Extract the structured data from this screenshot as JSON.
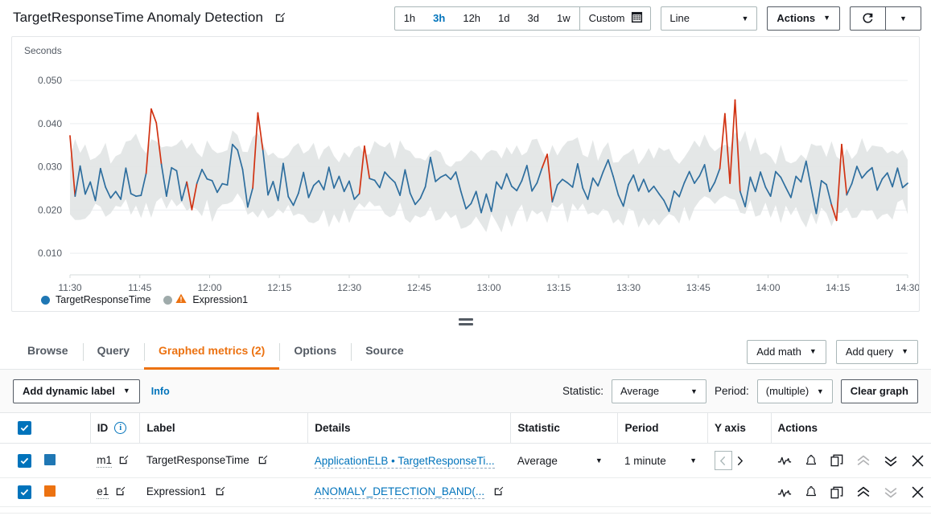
{
  "header": {
    "title": "TargetResponseTime Anomaly Detection",
    "edit_icon": "edit-pencil-icon",
    "time_ranges": [
      {
        "label": "1h",
        "active": false
      },
      {
        "label": "3h",
        "active": true
      },
      {
        "label": "12h",
        "active": false
      },
      {
        "label": "1d",
        "active": false
      },
      {
        "label": "3d",
        "active": false
      },
      {
        "label": "1w",
        "active": false
      }
    ],
    "custom_label": "Custom",
    "custom_icon": "calendar-icon",
    "chart_type": "Line",
    "actions_label": "Actions",
    "refresh_icon": "refresh-icon"
  },
  "chart_data": {
    "type": "line",
    "title": "",
    "ylabel": "Seconds",
    "xlabel": "",
    "ylim": [
      0.005,
      0.053
    ],
    "yticks": [
      0.05,
      0.04,
      0.03,
      0.02,
      0.01
    ],
    "ytick_labels": [
      "0.050",
      "0.040",
      "0.030",
      "0.020",
      "0.010"
    ],
    "xticks": [
      "11:30",
      "11:45",
      "12:00",
      "12:15",
      "12:30",
      "12:45",
      "13:00",
      "13:15",
      "13:30",
      "13:45",
      "14:00",
      "14:15",
      "14:30"
    ],
    "grid": true,
    "legend_position": "bottom-left",
    "legend": [
      {
        "name": "TargetResponseTime",
        "color": "#1f77b4",
        "marker": "circle"
      },
      {
        "name": "Expression1",
        "color": "#98a3a3",
        "marker": "circle",
        "warning_icon": "warning-triangle-icon",
        "warning_color": "#ec7211"
      }
    ],
    "series": [
      {
        "name": "TargetResponseTime",
        "color": "#2e6e9e",
        "anomaly_color": "#d13212",
        "unit": "Seconds",
        "values": [
          0.0372,
          0.0232,
          0.0302,
          0.0237,
          0.0265,
          0.0222,
          0.0296,
          0.0253,
          0.0228,
          0.0243,
          0.0225,
          0.0297,
          0.0238,
          0.0232,
          0.0234,
          0.0285,
          0.0434,
          0.0402,
          0.0306,
          0.0232,
          0.0298,
          0.0291,
          0.0222,
          0.0265,
          0.0201,
          0.0262,
          0.0294,
          0.0272,
          0.0268,
          0.0241,
          0.0261,
          0.0258,
          0.0352,
          0.0339,
          0.0294,
          0.0207,
          0.0251,
          0.0425,
          0.0338,
          0.0235,
          0.0266,
          0.0222,
          0.0308,
          0.0231,
          0.0211,
          0.0239,
          0.0287,
          0.0229,
          0.0257,
          0.0268,
          0.0247,
          0.0299,
          0.0251,
          0.0278,
          0.0243,
          0.0267,
          0.0225,
          0.0238,
          0.0348,
          0.0273,
          0.0269,
          0.0252,
          0.0288,
          0.0275,
          0.0264,
          0.0234,
          0.0293,
          0.0239,
          0.0213,
          0.0227,
          0.0254,
          0.0322,
          0.0266,
          0.0276,
          0.0282,
          0.0271,
          0.0288,
          0.0243,
          0.0203,
          0.0215,
          0.0243,
          0.0194,
          0.0237,
          0.0197,
          0.0265,
          0.0249,
          0.0284,
          0.0255,
          0.0245,
          0.0268,
          0.0303,
          0.0244,
          0.0263,
          0.0298,
          0.0329,
          0.0219,
          0.0258,
          0.0271,
          0.0263,
          0.0253,
          0.0307,
          0.0251,
          0.0225,
          0.0274,
          0.0256,
          0.0288,
          0.0316,
          0.0278,
          0.0235,
          0.0209,
          0.0259,
          0.0281,
          0.0244,
          0.0271,
          0.0242,
          0.0255,
          0.0238,
          0.0222,
          0.0197,
          0.0244,
          0.0231,
          0.0263,
          0.0289,
          0.0262,
          0.0279,
          0.0305,
          0.0243,
          0.0264,
          0.0296,
          0.0423,
          0.0262,
          0.0455,
          0.0243,
          0.0208,
          0.0276,
          0.0243,
          0.0288,
          0.0253,
          0.0232,
          0.0289,
          0.0276,
          0.0252,
          0.0229,
          0.0278,
          0.0265,
          0.0313,
          0.0251,
          0.0192,
          0.0268,
          0.0259,
          0.0212,
          0.0176,
          0.0352,
          0.0235,
          0.0261,
          0.0301,
          0.0274,
          0.0288,
          0.0298,
          0.0246,
          0.0272,
          0.0286,
          0.0254,
          0.0297,
          0.0252,
          0.0262
        ]
      },
      {
        "name": "Expression1",
        "type": "band",
        "color": "#dfe3e3",
        "description": "ANOMALY_DETECTION_BAND lower/upper bounds"
      }
    ]
  },
  "resizer": {
    "icon": "drag-handle-icon"
  },
  "tabs": [
    {
      "label": "Browse",
      "active": false
    },
    {
      "label": "Query",
      "active": false
    },
    {
      "label": "Graphed metrics (2)",
      "active": true
    },
    {
      "label": "Options",
      "active": false
    },
    {
      "label": "Source",
      "active": false
    }
  ],
  "tabs_right": [
    {
      "label": "Add math",
      "icon": "chevron-down-icon"
    },
    {
      "label": "Add query",
      "icon": "chevron-down-icon"
    }
  ],
  "controls": {
    "add_dynamic_label": "Add dynamic label",
    "info_label": "Info",
    "statistic_label": "Statistic:",
    "statistic_value": "Average",
    "period_label": "Period:",
    "period_value": "(multiple)",
    "clear_graph_label": "Clear graph"
  },
  "table": {
    "headers": [
      "",
      "",
      "ID",
      "Label",
      "Details",
      "Statistic",
      "Period",
      "Y axis",
      "Actions"
    ],
    "id_info_icon": "info-icon",
    "rows": [
      {
        "checked": true,
        "color": "#1f77b4",
        "id": "m1",
        "label": "TargetResponseTime",
        "details": "ApplicationELB • TargetResponseTi...",
        "statistic": "Average",
        "period": "1 minute",
        "yaxis_left_icon": "chevron-left-icon",
        "yaxis_right_icon": "chevron-right-icon",
        "actions": [
          "pulse-icon",
          "bell-icon",
          "duplicate-icon",
          "move-up-icon",
          "move-down-icon",
          "close-icon"
        ],
        "move_up_disabled": true,
        "move_down_disabled": false
      },
      {
        "checked": true,
        "color": "#ec7211",
        "id": "e1",
        "label": "Expression1",
        "details": "ANOMALY_DETECTION_BAND(...",
        "statistic": "",
        "period": "",
        "actions": [
          "pulse-icon",
          "bell-icon",
          "duplicate-icon",
          "move-up-icon",
          "move-down-icon",
          "close-icon"
        ],
        "move_up_disabled": false,
        "move_down_disabled": true
      }
    ]
  },
  "colors": {
    "accent_orange": "#ec7211",
    "link_blue": "#0073bb",
    "series_blue": "#2e6e9e",
    "anomaly_red": "#d13212",
    "band_gray": "#dfe3e3"
  }
}
